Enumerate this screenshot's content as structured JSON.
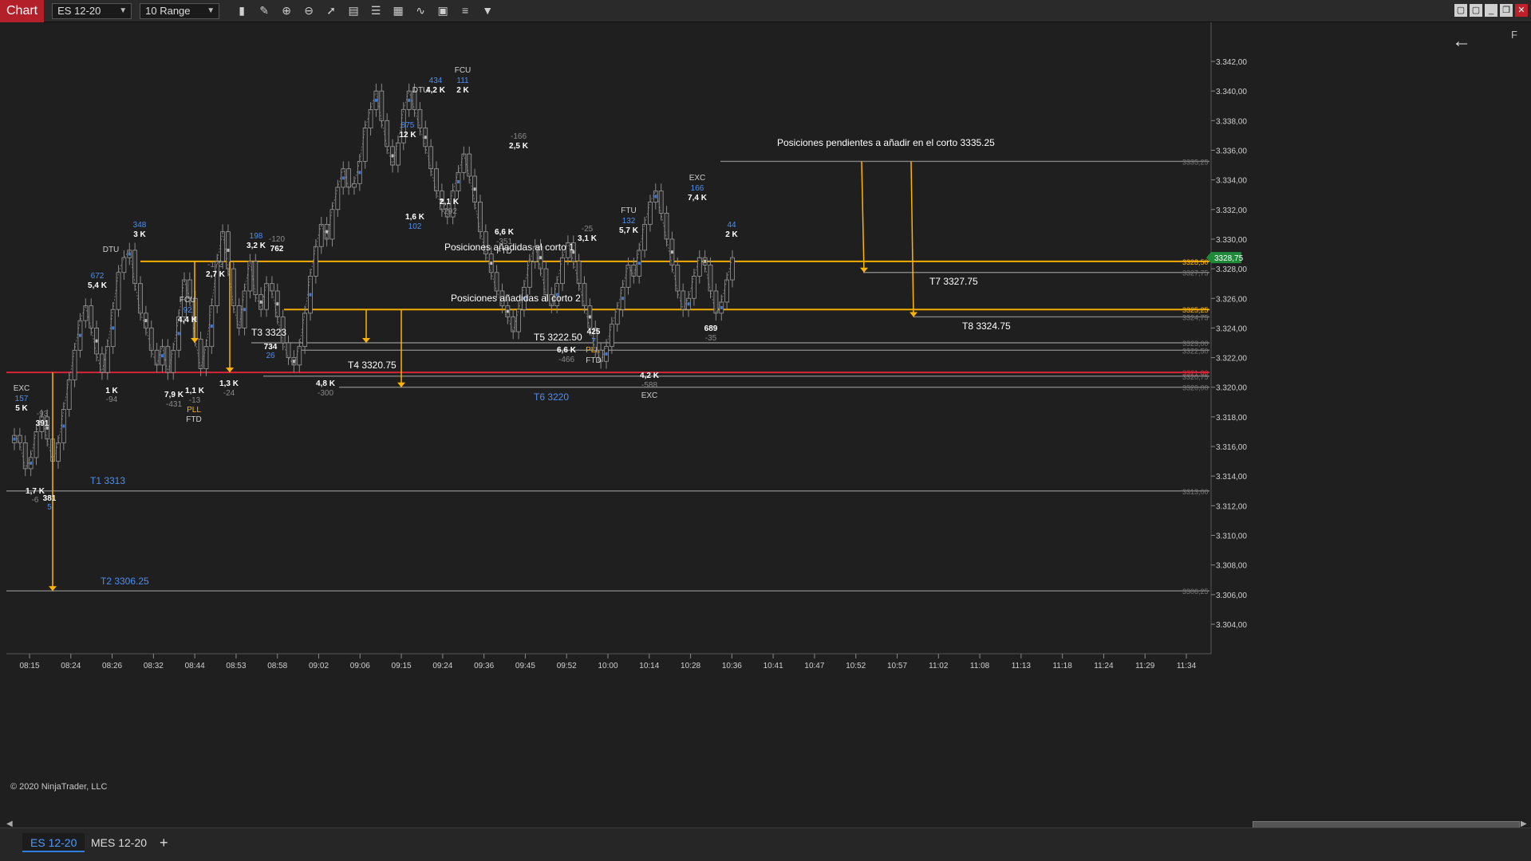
{
  "topbar": {
    "chart_tab": "Chart",
    "instrument": "ES 12-20",
    "period": "10 Range",
    "tool_icons": [
      "bar-type-icon",
      "pencil-icon",
      "zoom-in-icon",
      "zoom-out-icon",
      "pointer-icon",
      "data-box-icon",
      "properties-icon",
      "indicators-icon",
      "strategies-icon",
      "templates-icon",
      "list-icon",
      "filter-icon"
    ],
    "window_icons": [
      "tile-icon",
      "tile-icon",
      "minimize-icon",
      "restore-icon",
      "close-icon"
    ]
  },
  "drawbar_icons": [
    "ruler-icon",
    "risk-reward-icon",
    "line-icon",
    "ray-icon",
    "extended-line-icon",
    "arrow-line-icon",
    "horizontal-line-icon",
    "vertical-line-icon",
    "fib-retracement-icon",
    "fib-extension-icon",
    "channel-icon",
    "ellipse-icon",
    "rectangle-icon",
    "text-icon",
    "arrow-icon",
    "circle-icon",
    "triangle-up-icon",
    "triangle-down-icon",
    "draw-settings-icon"
  ],
  "back_label": "←",
  "f_label": "F",
  "copyright": "© 2020 NinjaTrader, LLC",
  "tabs": [
    "ES 12-20",
    "MES 12-20"
  ],
  "add_tab": "+",
  "chart_data": {
    "type": "candlestick",
    "instrument": "ES 12-20",
    "period": "10 Range",
    "ylim": [
      3302.5,
      3344.25
    ],
    "yticks": [
      3342,
      3340,
      3338,
      3336,
      3334,
      3332,
      3330,
      3328,
      3326,
      3324,
      3322,
      3320,
      3318,
      3316,
      3314,
      3312,
      3310,
      3308,
      3306,
      3304
    ],
    "y_format_suffix": ",00",
    "x_labels": [
      "08:15",
      "08:24",
      "08:26",
      "08:32",
      "08:44",
      "08:53",
      "08:58",
      "09:02",
      "09:06",
      "09:15",
      "09:24",
      "09:36",
      "09:45",
      "09:52",
      "10:00",
      "10:14",
      "10:28",
      "10:36",
      "10:41",
      "10:47",
      "10:52",
      "10:57",
      "11:02",
      "11:08",
      "11:13",
      "11:18",
      "11:24",
      "11:29",
      "11:34"
    ],
    "bar_count": 136,
    "last_price": "3328,75",
    "last_price_value": 3328.75,
    "colors": {
      "up": "#3f78d6",
      "down": "#9a9a9a",
      "level": "#ffb400",
      "stop": "#e0263a",
      "target": "#888888"
    },
    "close_path": [
      3316.75,
      3316.25,
      3314.5,
      3315.25,
      3317,
      3318,
      3316.5,
      3315,
      3316.25,
      3318.5,
      3320.5,
      3322.5,
      3324.5,
      3325.5,
      3324,
      3322.25,
      3321,
      3322.75,
      3325.25,
      3327.75,
      3328.75,
      3329.25,
      3327,
      3325,
      3324,
      3322.5,
      3321.5,
      3322.75,
      3321,
      3322.5,
      3324.75,
      3327.25,
      3326,
      3323.25,
      3321.25,
      3322.75,
      3325.5,
      3328.5,
      3330.5,
      3328,
      3325.5,
      3324,
      3326.5,
      3328.5,
      3326.25,
      3325.25,
      3327,
      3326.5,
      3324.75,
      3323,
      3322,
      3321.5,
      3322.75,
      3325,
      3327.5,
      3329.5,
      3331,
      3330,
      3332,
      3333.5,
      3334.75,
      3333.5,
      3333.75,
      3335.25,
      3337.5,
      3338.75,
      3340,
      3338,
      3336.25,
      3335,
      3336.5,
      3338.75,
      3340,
      3338.75,
      3337.5,
      3336.25,
      3334.75,
      3333.25,
      3332,
      3331.5,
      3333.25,
      3334.5,
      3335.75,
      3334.25,
      3332.5,
      3330.5,
      3329,
      3327.75,
      3326.5,
      3325.5,
      3324.75,
      3323.75,
      3325.25,
      3326.75,
      3328.5,
      3329.5,
      3328,
      3326.25,
      3325.5,
      3327,
      3328.75,
      3329.75,
      3328.5,
      3327,
      3325.5,
      3324,
      3322.5,
      3321.75,
      3322.75,
      3324.25,
      3325.25,
      3326.75,
      3328.25,
      3327.5,
      3329.25,
      3331,
      3332.5,
      3333.25,
      3331.75,
      3330,
      3328.25,
      3326.5,
      3325.25,
      3326,
      3327.5,
      3328.75,
      3328.25,
      3326.5,
      3325,
      3325.75,
      3327.25,
      3328.75
    ],
    "horizontal_levels": [
      {
        "label": "3335,25",
        "value": 3335.25,
        "color": "#888888"
      },
      {
        "label": "3328,50",
        "value": 3328.5,
        "color": "#ffb400"
      },
      {
        "label": "3327,75",
        "value": 3327.75,
        "color": "#888888"
      },
      {
        "label": "3325,25",
        "value": 3325.25,
        "color": "#ffb400"
      },
      {
        "label": "3324,75",
        "value": 3324.75,
        "color": "#888888"
      },
      {
        "label": "3323,00",
        "value": 3323.0,
        "color": "#888888"
      },
      {
        "label": "3322,50",
        "value": 3322.5,
        "color": "#888888"
      },
      {
        "label": "3321,00",
        "value": 3321.0,
        "color": "#e0263a"
      },
      {
        "label": "3320,75",
        "value": 3320.75,
        "color": "#888888"
      },
      {
        "label": "3320,00",
        "value": 3320.0,
        "color": "#888888"
      },
      {
        "label": "3313,00",
        "value": 3313.0,
        "color": "#888888"
      },
      {
        "label": "3306,25",
        "value": 3306.25,
        "color": "#888888"
      }
    ],
    "target_labels": [
      {
        "text": "T1 3313",
        "color": "#4d8ef0"
      },
      {
        "text": "T2 3306.25",
        "color": "#4d8ef0"
      },
      {
        "text": "T3 3323",
        "color": "#ffffff"
      },
      {
        "text": "T4 3320.75",
        "color": "#ffffff"
      },
      {
        "text": "T5 3222.50",
        "color": "#ffffff"
      },
      {
        "text": "T6 3220",
        "color": "#4d8ef0"
      },
      {
        "text": "T7 3327.75",
        "color": "#ffffff"
      },
      {
        "text": "T8 3324.75",
        "color": "#ffffff"
      }
    ],
    "notes": [
      "Posiciones pendientes a añadir en el corto 3335.25",
      "Posiciones añadidas al corto 1",
      "Posiciones añadidas al corto 2"
    ],
    "bar_annotations": [
      [
        "EXC",
        "#cfcfcf"
      ],
      [
        "157",
        "#4d8ef0"
      ],
      [
        "5 K",
        "#ffffff"
      ],
      [
        "-93",
        "#8a8a8a"
      ],
      [
        "391",
        "#ffffff"
      ],
      [
        "1,7 K",
        "#ffffff"
      ],
      [
        "-6",
        "#8a8a8a"
      ],
      [
        "381",
        "#ffffff"
      ],
      [
        "5",
        "#4d8ef0"
      ],
      [
        "672",
        "#4d8ef0"
      ],
      [
        "5,4 K",
        "#ffffff"
      ],
      [
        "1 K",
        "#ffffff"
      ],
      [
        "-94",
        "#8a8a8a"
      ],
      [
        "DTU",
        "#cfcfcf"
      ],
      [
        "348",
        "#4d8ef0"
      ],
      [
        "3 K",
        "#ffffff"
      ],
      [
        "FCU",
        "#cfcfcf"
      ],
      [
        "92",
        "#4d8ef0"
      ],
      [
        "4,4 K",
        "#ffffff"
      ],
      [
        "7,9 K",
        "#ffffff"
      ],
      [
        "-431",
        "#8a8a8a"
      ],
      [
        "1,1 K",
        "#ffffff"
      ],
      [
        "-13",
        "#8a8a8a"
      ],
      [
        "PLL",
        "#ffb400"
      ],
      [
        "FTD",
        "#cfcfcf"
      ],
      [
        "-173",
        "#8a8a8a"
      ],
      [
        "2,7 K",
        "#ffffff"
      ],
      [
        "1,3 K",
        "#ffffff"
      ],
      [
        "-24",
        "#8a8a8a"
      ],
      [
        "198",
        "#4d8ef0"
      ],
      [
        "3,2 K",
        "#ffffff"
      ],
      [
        "-120",
        "#8a8a8a"
      ],
      [
        "762",
        "#ffffff"
      ],
      [
        "734",
        "#ffffff"
      ],
      [
        "26",
        "#4d8ef0"
      ],
      [
        "4,8 K",
        "#ffffff"
      ],
      [
        "-300",
        "#8a8a8a"
      ],
      [
        "875",
        "#4d8ef0"
      ],
      [
        "12 K",
        "#ffffff"
      ],
      [
        "1,6 K",
        "#ffffff"
      ],
      [
        "102",
        "#4d8ef0"
      ],
      [
        "DTU",
        "#cfcfcf"
      ],
      [
        "434",
        "#4d8ef0"
      ],
      [
        "4,2 K",
        "#ffffff"
      ],
      [
        "FCU",
        "#cfcfcf"
      ],
      [
        "111",
        "#4d8ef0"
      ],
      [
        "2 K",
        "#ffffff"
      ],
      [
        "2,1 K",
        "#ffffff"
      ],
      [
        "-292",
        "#8a8a8a"
      ],
      [
        "-166",
        "#8a8a8a"
      ],
      [
        "2,5 K",
        "#ffffff"
      ],
      [
        "6,6 K",
        "#ffffff"
      ],
      [
        "-351",
        "#8a8a8a"
      ],
      [
        "FTD",
        "#cfcfcf"
      ],
      [
        "-25",
        "#8a8a8a"
      ],
      [
        "3,1 K",
        "#ffffff"
      ],
      [
        "425",
        "#ffffff"
      ],
      [
        "7",
        "#4d8ef0"
      ],
      [
        "PLL",
        "#ffb400"
      ],
      [
        "FTD",
        "#cfcfcf"
      ],
      [
        "6,6 K",
        "#ffffff"
      ],
      [
        "-466",
        "#8a8a8a"
      ],
      [
        "FTU",
        "#cfcfcf"
      ],
      [
        "132",
        "#4d8ef0"
      ],
      [
        "5,7 K",
        "#ffffff"
      ],
      [
        "4,2 K",
        "#ffffff"
      ],
      [
        "-588",
        "#8a8a8a"
      ],
      [
        "EXC",
        "#cfcfcf"
      ],
      [
        "EXC",
        "#cfcfcf"
      ],
      [
        "166",
        "#4d8ef0"
      ],
      [
        "7,4 K",
        "#ffffff"
      ],
      [
        "689",
        "#ffffff"
      ],
      [
        "-35",
        "#8a8a8a"
      ],
      [
        "44",
        "#4d8ef0"
      ],
      [
        "2 K",
        "#ffffff"
      ]
    ]
  }
}
